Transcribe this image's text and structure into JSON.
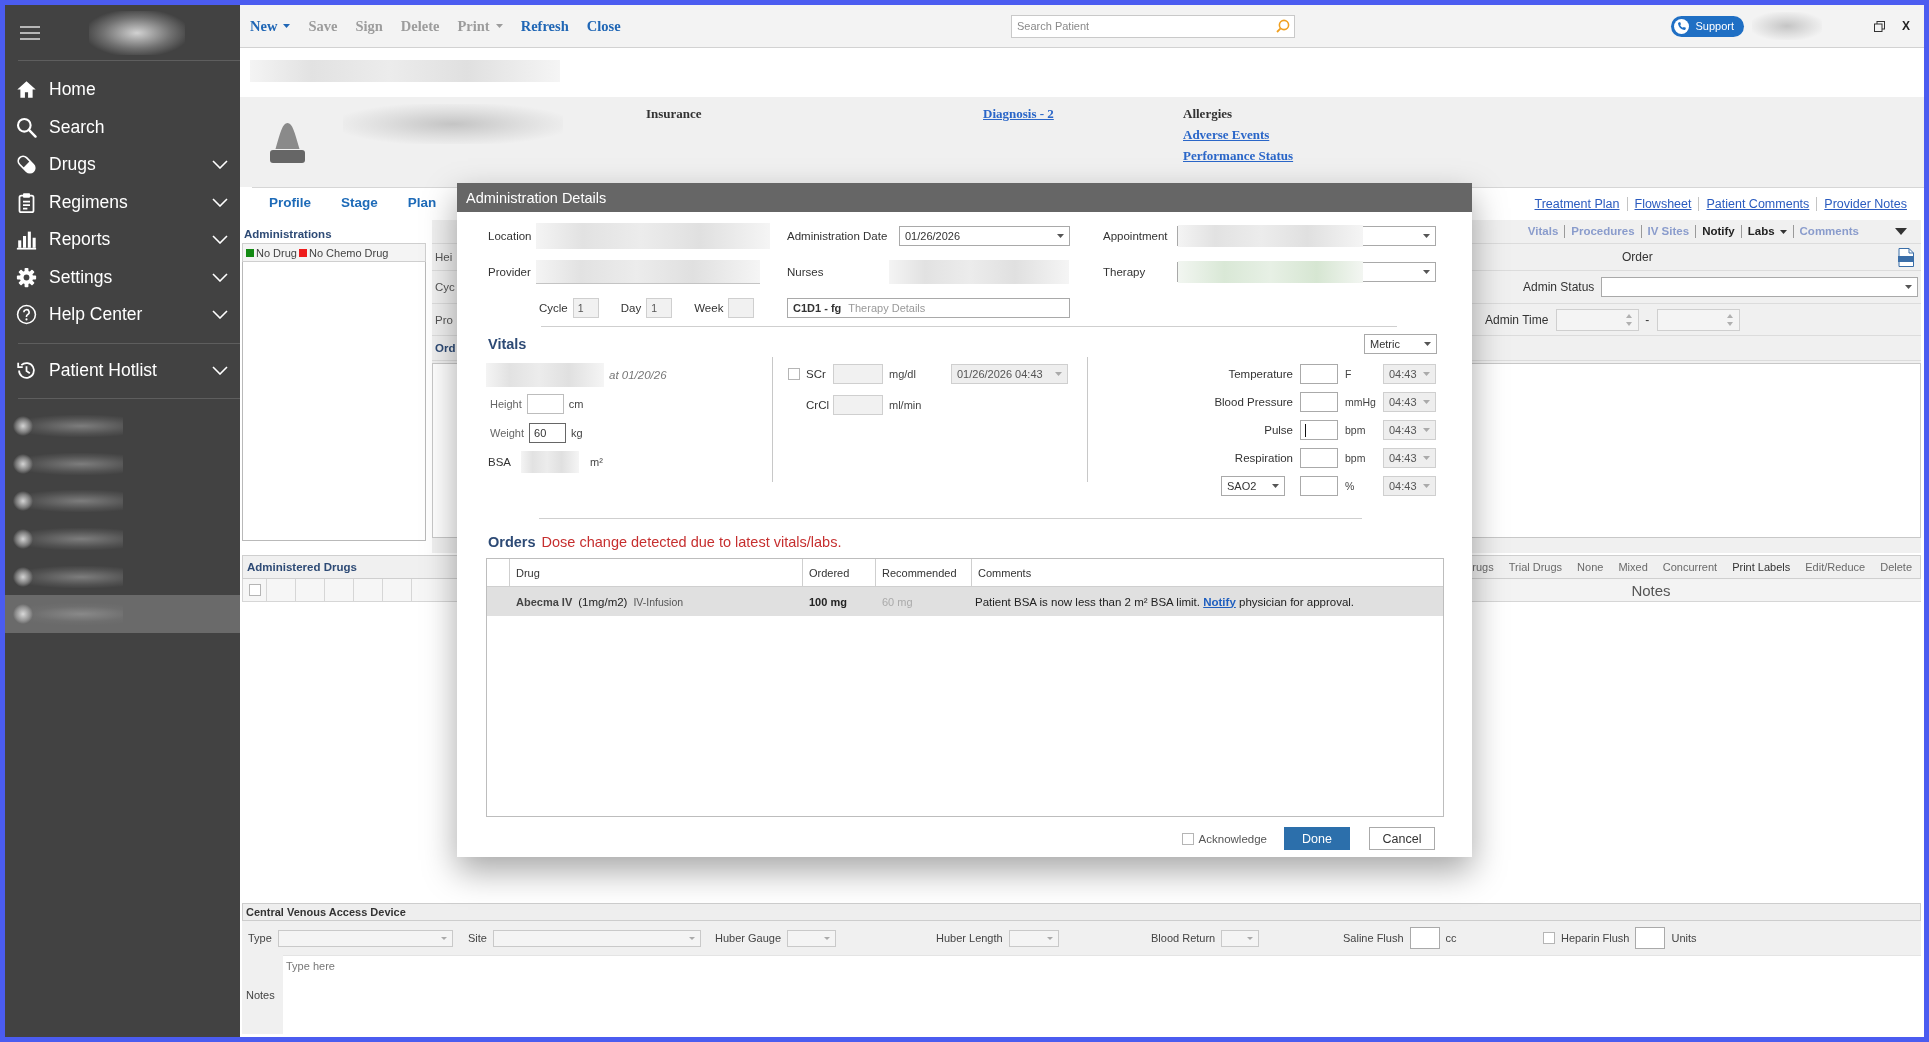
{
  "sidebar": {
    "items": [
      {
        "label": "Home",
        "expandable": false
      },
      {
        "label": "Search",
        "expandable": false
      },
      {
        "label": "Drugs",
        "expandable": true
      },
      {
        "label": "Regimens",
        "expandable": true
      },
      {
        "label": "Reports",
        "expandable": true
      },
      {
        "label": "Settings",
        "expandable": true
      },
      {
        "label": "Help Center",
        "expandable": true
      }
    ],
    "hotlist": {
      "label": "Patient Hotlist",
      "expandable": true
    },
    "hotlist_entries": [
      {
        "selected": false
      },
      {
        "selected": false
      },
      {
        "selected": false
      },
      {
        "selected": false
      },
      {
        "selected": false
      },
      {
        "selected": true
      }
    ]
  },
  "toolbar": {
    "buttons": [
      {
        "label": "New",
        "disabled": false,
        "dropdown": true
      },
      {
        "label": "Save",
        "disabled": true,
        "dropdown": false
      },
      {
        "label": "Sign",
        "disabled": true,
        "dropdown": false
      },
      {
        "label": "Delete",
        "disabled": true,
        "dropdown": false
      },
      {
        "label": "Print",
        "disabled": true,
        "dropdown": true
      },
      {
        "label": "Refresh",
        "disabled": false,
        "dropdown": false
      },
      {
        "label": "Close",
        "disabled": false,
        "dropdown": false
      }
    ],
    "search": {
      "placeholder": "Search Patient"
    },
    "support_button": "Support",
    "close_button": "X"
  },
  "patient_header": {
    "insurance_label": "Insurance",
    "diagnosis_link": "Diagnosis - 2",
    "allergies_label": "Allergies",
    "links": [
      "Adverse Events",
      "Performance Status"
    ]
  },
  "tabs": [
    {
      "label": "Profile",
      "selected": false
    },
    {
      "label": "Stage",
      "selected": false
    },
    {
      "label": "Plan",
      "selected": false
    }
  ],
  "record_links": [
    "Treatment Plan",
    "Flowsheet",
    "Patient Comments",
    "Provider Notes"
  ],
  "section_links": [
    {
      "label": "Vitals",
      "active": false,
      "dropdown": false
    },
    {
      "label": "Procedures",
      "active": false,
      "dropdown": false
    },
    {
      "label": "IV Sites",
      "active": false,
      "dropdown": false
    },
    {
      "label": "Notify",
      "active": true,
      "dropdown": false
    },
    {
      "label": "Labs",
      "active": true,
      "dropdown": true
    },
    {
      "label": "Comments",
      "active": false,
      "dropdown": false
    }
  ],
  "administrations": {
    "title": "Administrations",
    "legend": [
      {
        "label": "No Drug",
        "color": "#138a13"
      },
      {
        "label": "No Chemo Drug",
        "color": "#ee1c1c"
      }
    ]
  },
  "detail_rows": [
    {
      "label": "Hei",
      "kind": "field"
    },
    {
      "label": "Cyc",
      "kind": "field"
    },
    {
      "label": "Pro",
      "kind": "field"
    },
    {
      "label": "Ord",
      "kind": "heading"
    }
  ],
  "order_panel": {
    "title": "Order",
    "admin_status_label": "Admin Status",
    "admin_time_label": "Admin Time",
    "time_separator": "-"
  },
  "administered_drugs": {
    "title": "Administered Drugs",
    "actions": [
      {
        "label": "rugs",
        "disabled": true
      },
      {
        "label": "Trial Drugs",
        "disabled": true
      },
      {
        "label": "None",
        "disabled": true
      },
      {
        "label": "Mixed",
        "disabled": true
      },
      {
        "label": "Concurrent",
        "disabled": true
      },
      {
        "label": "Print Labels",
        "disabled": false
      },
      {
        "label": "Edit/Reduce",
        "disabled": true
      },
      {
        "label": "Delete",
        "disabled": true
      }
    ],
    "select_all": {
      "checked": false
    },
    "notes_title": "Notes"
  },
  "cvad": {
    "title": "Central Venous Access Device",
    "fields": [
      {
        "kind": "select",
        "label": "Type"
      },
      {
        "kind": "select",
        "label": "Site"
      },
      {
        "kind": "select",
        "label": "Huber Gauge"
      },
      {
        "kind": "select",
        "label": "Huber Length"
      },
      {
        "kind": "select",
        "label": "Blood Return"
      },
      {
        "kind": "input",
        "label": "Saline Flush",
        "unit": "cc"
      },
      {
        "kind": "checkbox_input",
        "label": "Heparin Flush",
        "checked": false,
        "unit": "Units"
      }
    ],
    "notes_label": "Notes",
    "notes_placeholder": "Type here"
  },
  "dialog": {
    "title": "Administration Details",
    "location_label": "Location",
    "admin_date": {
      "label": "Administration Date",
      "value": "01/26/2026"
    },
    "appointment_label": "Appointment",
    "provider_label": "Provider",
    "nurses_label": "Nurses",
    "therapy_label": "Therapy",
    "schedule": [
      {
        "label": "Cycle",
        "value": "1"
      },
      {
        "label": "Day",
        "value": "1"
      },
      {
        "label": "Week"
      }
    ],
    "therapy_details": {
      "value": "C1D1 - fg",
      "placeholder": "Therapy Details"
    },
    "vitals": {
      "title": "Vitals",
      "unit_system": "Metric",
      "recorded": "at 01/20/26",
      "body": [
        {
          "kind": "input",
          "label": "Height",
          "unit": "cm"
        },
        {
          "kind": "input",
          "label": "Weight",
          "value": "60",
          "unit": "kg"
        },
        {
          "kind": "computed",
          "label": "BSA",
          "unit": "m²"
        }
      ],
      "labs": [
        {
          "label": "SCr",
          "checked": false,
          "unit": "mg/dl",
          "time": "01/26/2026 04:43"
        },
        {
          "label": "CrCl",
          "unit": "ml/min"
        }
      ],
      "signs": [
        {
          "kind": "label",
          "label": "Temperature",
          "unit": "F",
          "time": "04:43",
          "focused": false
        },
        {
          "kind": "label",
          "label": "Blood Pressure",
          "unit": "mmHg",
          "time": "04:43",
          "focused": false
        },
        {
          "kind": "label",
          "label": "Pulse",
          "unit": "bpm",
          "time": "04:43",
          "focused": true
        },
        {
          "kind": "label",
          "label": "Respiration",
          "unit": "bpm",
          "time": "04:43",
          "focused": false
        },
        {
          "kind": "select",
          "label": "SAO2",
          "unit": "%",
          "time": "04:43",
          "focused": false
        }
      ]
    },
    "orders": {
      "title": "Orders",
      "alert": "Dose change detected due to latest vitals/labs.",
      "columns": [
        "Drug",
        "Ordered",
        "Recommended",
        "Comments"
      ],
      "rows": [
        {
          "selected": true,
          "drug": "Abecma IV",
          "dose": "(1mg/m2)",
          "route": "IV-Infusion",
          "ordered": "100 mg",
          "recommended": "60 mg",
          "comment": "Patient BSA is now less than 2 m² BSA limit.",
          "comment_link": "Notify",
          "comment_end": "physician for approval."
        }
      ]
    },
    "acknowledge": {
      "label": "Acknowledge",
      "checked": false
    },
    "buttons": [
      {
        "label": "Done",
        "kind": "primary"
      },
      {
        "label": "Cancel",
        "kind": "secondary"
      }
    ]
  }
}
